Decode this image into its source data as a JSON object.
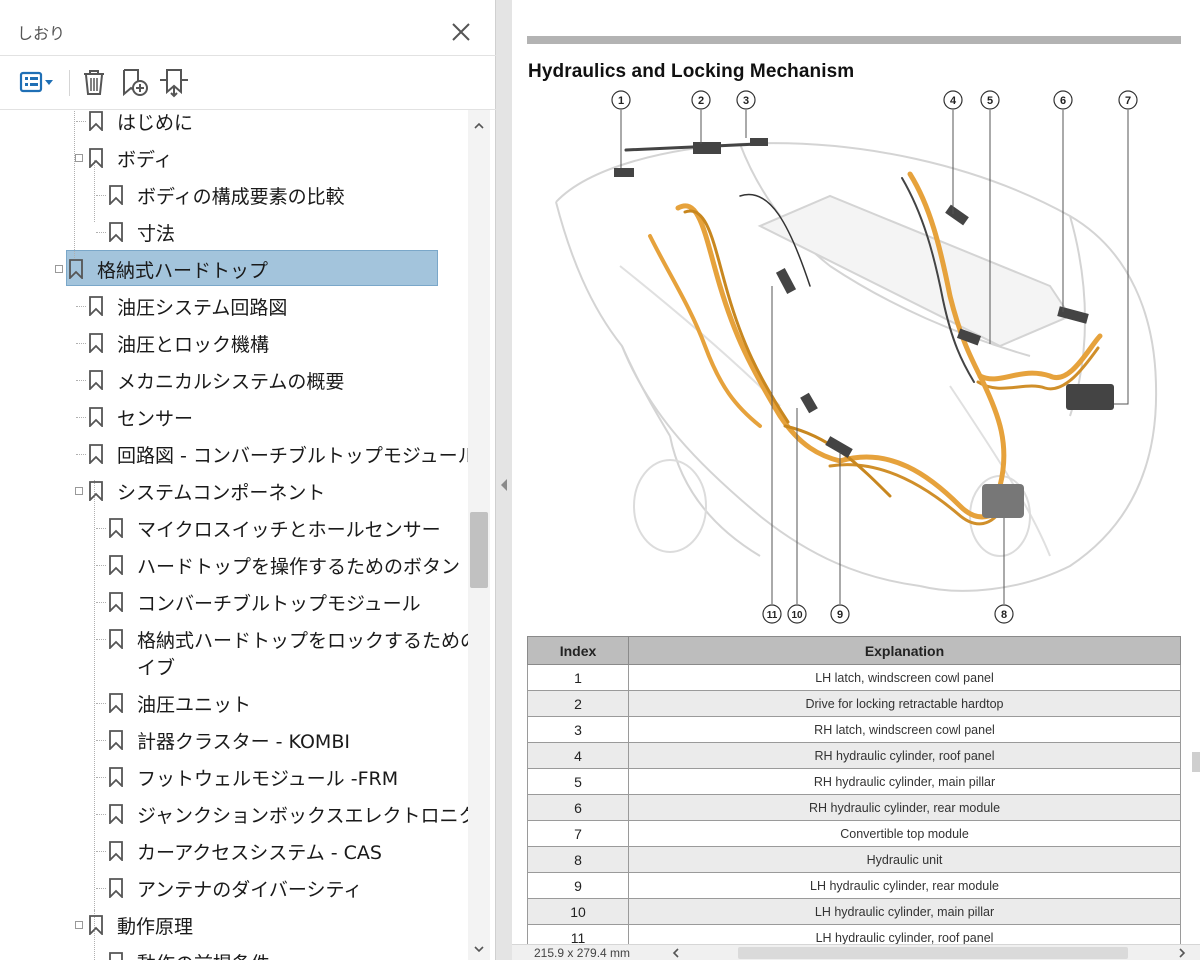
{
  "bookmarks_panel": {
    "title": "しおり",
    "tree": [
      {
        "label": "はじめに",
        "level": 0,
        "partial": true
      },
      {
        "label": "ボディ",
        "level": 0,
        "expanded": true
      },
      {
        "label": "ボディの構成要素の比較",
        "level": 1
      },
      {
        "label": "寸法",
        "level": 1
      },
      {
        "label": "格納式ハードトップ",
        "level": -1,
        "expanded": true,
        "selected": true
      },
      {
        "label": "油圧システム回路図",
        "level": 0
      },
      {
        "label": "油圧とロック機構",
        "level": 0
      },
      {
        "label": "メカニカルシステムの概要",
        "level": 0
      },
      {
        "label": "センサー",
        "level": 0
      },
      {
        "label": "回路図 - コンバーチブルトップモジュール",
        "level": 0
      },
      {
        "label": "システムコンポーネント",
        "level": 0,
        "expanded": true
      },
      {
        "label": "マイクロスイッチとホールセンサー",
        "level": 1
      },
      {
        "label": "ハードトップを操作するためのボタン",
        "level": 1
      },
      {
        "label": "コンバーチブルトップモジュール",
        "level": 1
      },
      {
        "label": "格納式ハードトップをロックするためのドラ",
        "label2": "イブ",
        "level": 1
      },
      {
        "label": "油圧ユニット",
        "level": 1
      },
      {
        "label": "計器クラスター - KOMBI",
        "level": 1
      },
      {
        "label": "フットウェルモジュール -FRM",
        "level": 1
      },
      {
        "label": "ジャンクションボックスエレクトロニクス - JBE",
        "level": 1
      },
      {
        "label": "カーアクセスシステム - CAS",
        "level": 1
      },
      {
        "label": "アンテナのダイバーシティ",
        "level": 1
      },
      {
        "label": "動作原理",
        "level": 0,
        "expanded": true
      },
      {
        "label": "動作の前提条件",
        "level": 1,
        "partial": true
      }
    ]
  },
  "document": {
    "heading": "Hydraulics and Locking Mechanism",
    "callout_numbers": [
      "1",
      "2",
      "3",
      "4",
      "5",
      "6",
      "7",
      "8",
      "9",
      "10",
      "11"
    ],
    "table": {
      "headers": [
        "Index",
        "Explanation"
      ],
      "rows": [
        [
          "1",
          "LH latch, windscreen cowl panel"
        ],
        [
          "2",
          "Drive for locking retractable hardtop"
        ],
        [
          "3",
          "RH latch, windscreen cowl panel"
        ],
        [
          "4",
          "RH hydraulic cylinder, roof panel"
        ],
        [
          "5",
          "RH hydraulic cylinder, main pillar"
        ],
        [
          "6",
          "RH hydraulic cylinder, rear module"
        ],
        [
          "7",
          "Convertible top module"
        ],
        [
          "8",
          "Hydraulic unit"
        ],
        [
          "9",
          "LH hydraulic cylinder, rear module"
        ],
        [
          "10",
          "LH hydraulic cylinder, main pillar"
        ],
        [
          "11",
          "LH hydraulic cylinder, roof panel"
        ]
      ]
    }
  },
  "status_bar": {
    "page_size": "215.9 x 279.4 mm"
  },
  "icons": [
    "close-icon",
    "bookmark-options-icon",
    "delete-icon",
    "new-bookmark-icon",
    "expand-bookmark-icon",
    "bookmark-icon",
    "chevron-up-icon",
    "chevron-down-icon",
    "chevron-left-icon",
    "chevron-right-icon"
  ],
  "colors": {
    "selection": "#a3c4dc",
    "toolbar_icon": "#1f6fb5",
    "hydraulic_lines": "#e6a23c",
    "table_header": "#bdbdbd"
  }
}
